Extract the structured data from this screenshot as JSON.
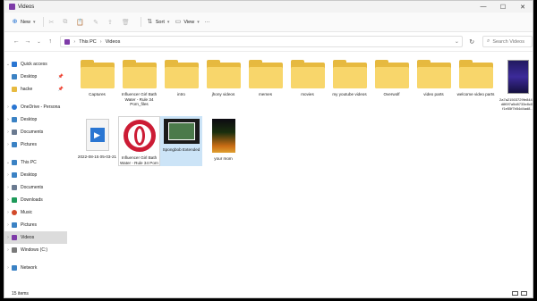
{
  "window": {
    "title": "Videos",
    "minimize": "—",
    "maximize": "☐",
    "close": "✕"
  },
  "toolbar": {
    "new_label": "New",
    "sort_label": "Sort",
    "view_label": "View",
    "more_label": "···"
  },
  "address": {
    "crumbs": [
      "This PC",
      "Videos"
    ],
    "search_placeholder": "Search Videos"
  },
  "sidebar": {
    "items": [
      {
        "label": "Quick access",
        "color": "#2a76d2"
      },
      {
        "label": "Desktop",
        "color": "#3b82c4"
      },
      {
        "label": "hacke",
        "color": "#e7ba40"
      },
      {
        "label": "OneDrive - Persona",
        "color": "#2a76d2"
      },
      {
        "label": "Desktop",
        "color": "#3b82c4"
      },
      {
        "label": "Documents",
        "color": "#6a7a90"
      },
      {
        "label": "Pictures",
        "color": "#3b82c4"
      },
      {
        "label": "This PC",
        "color": "#3b82c4"
      },
      {
        "label": "Desktop",
        "color": "#3b82c4"
      },
      {
        "label": "Documents",
        "color": "#6a7a90"
      },
      {
        "label": "Downloads",
        "color": "#1e9a5a"
      },
      {
        "label": "Music",
        "color": "#d24a2a"
      },
      {
        "label": "Pictures",
        "color": "#3b82c4"
      },
      {
        "label": "Videos",
        "color": "#7e3ba8"
      },
      {
        "label": "Windows (C:)",
        "color": "#7a7a7a"
      },
      {
        "label": "Network",
        "color": "#3b82c4"
      }
    ]
  },
  "files": [
    {
      "label": "Captures",
      "kind": "folder"
    },
    {
      "label": "Influencer Girl Bath Water - Rule 34 Porn_files",
      "kind": "folder"
    },
    {
      "label": "intro",
      "kind": "folder"
    },
    {
      "label": "jhony videos",
      "kind": "folder"
    },
    {
      "label": "memes",
      "kind": "folder"
    },
    {
      "label": "movies",
      "kind": "folder"
    },
    {
      "label": "my youtube videos",
      "kind": "folder"
    },
    {
      "label": "Overwolf",
      "kind": "folder"
    },
    {
      "label": "video parts",
      "kind": "folder"
    },
    {
      "label": "welcome video parts",
      "kind": "folder"
    },
    {
      "label": "2a7a21503729fe844ac d8f0f7a5d8733e8c01 f1e55f7b54d4ad8...",
      "kind": "video-thumb"
    },
    {
      "label": "2022-08-15 05-03-21",
      "kind": "video-file"
    },
    {
      "label": "Influencer Girl Bath Water - Rule 34 Porn",
      "kind": "opera"
    },
    {
      "label": "Spongbob Extended",
      "kind": "film"
    },
    {
      "label": "your mom",
      "kind": "game"
    }
  ],
  "status": {
    "count": "15 items"
  }
}
